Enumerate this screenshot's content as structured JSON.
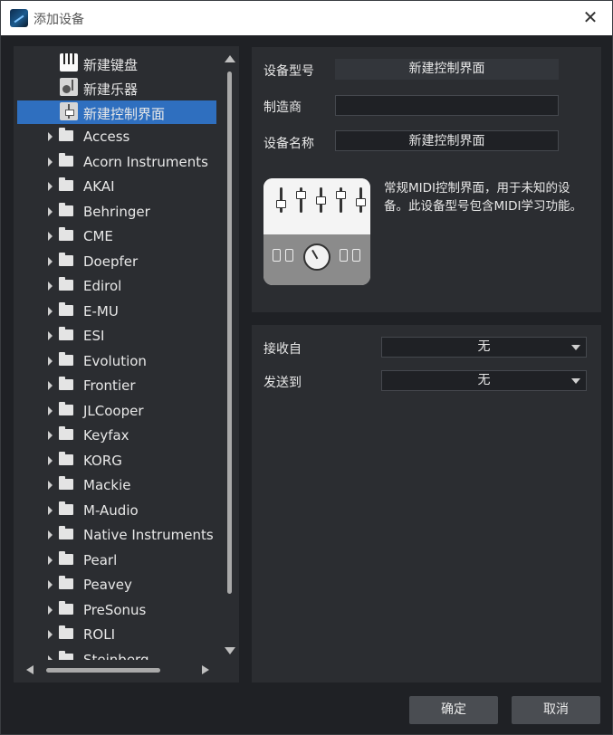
{
  "window": {
    "title": "添加设备"
  },
  "tree": {
    "top_items": [
      {
        "label": "新建键盘",
        "icon": "keyboard-icon"
      },
      {
        "label": "新建乐器",
        "icon": "instrument-icon"
      },
      {
        "label": "新建控制界面",
        "icon": "fader-icon",
        "selected": true
      }
    ],
    "folders": [
      "Access",
      "Acorn Instruments",
      "AKAI",
      "Behringer",
      "CME",
      "Doepfer",
      "Edirol",
      "E-MU",
      "ESI",
      "Evolution",
      "Frontier",
      "JLCooper",
      "Keyfax",
      "KORG",
      "Mackie",
      "M-Audio",
      "Native Instruments",
      "Pearl",
      "Peavey",
      "PreSonus",
      "ROLI",
      "Steinberg"
    ]
  },
  "device": {
    "model_label": "设备型号",
    "model_value": "新建控制界面",
    "maker_label": "制造商",
    "maker_value": "",
    "name_label": "设备名称",
    "name_value": "新建控制界面",
    "description": "常规MIDI控制界面，用于未知的设备。此设备型号包含MIDI学习功能。"
  },
  "routing": {
    "receive_label": "接收自",
    "receive_value": "无",
    "send_label": "发送到",
    "send_value": "无"
  },
  "buttons": {
    "ok": "确定",
    "cancel": "取消"
  },
  "colors": {
    "selection": "#2f6fbf",
    "panel": "#2b2d31",
    "background": "#1f2125"
  }
}
